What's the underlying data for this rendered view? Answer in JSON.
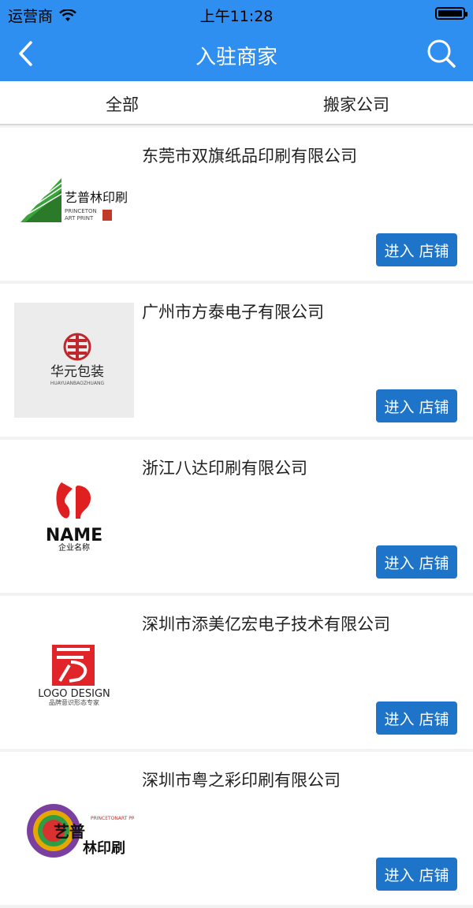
{
  "status": {
    "carrier": "运营商",
    "time": "上午11:28"
  },
  "nav": {
    "title": "入驻商家"
  },
  "tabs": [
    {
      "label": "全部"
    },
    {
      "label": "搬家公司"
    }
  ],
  "enter_label": "进入 店铺",
  "merchants": [
    {
      "name": "东莞市双旗纸品印刷有限公司",
      "logo": "艺普林印刷 PRINCETON ART PRINT"
    },
    {
      "name": "广州市方泰电子有限公司",
      "logo": "华元包装 HUAYUANBAOZHUANG"
    },
    {
      "name": "浙江八达印刷有限公司",
      "logo": "NAME 企业名称"
    },
    {
      "name": "深圳市添美亿宏电子技术有限公司",
      "logo": "LOGO DESIGN 品牌意识形态专家"
    },
    {
      "name": "深圳市粤之彩印刷有限公司",
      "logo": "艺普 林印刷 PRINCETONART PRINT"
    }
  ],
  "colors": {
    "nav": "#2f8ff0",
    "button": "#1d74c8"
  }
}
